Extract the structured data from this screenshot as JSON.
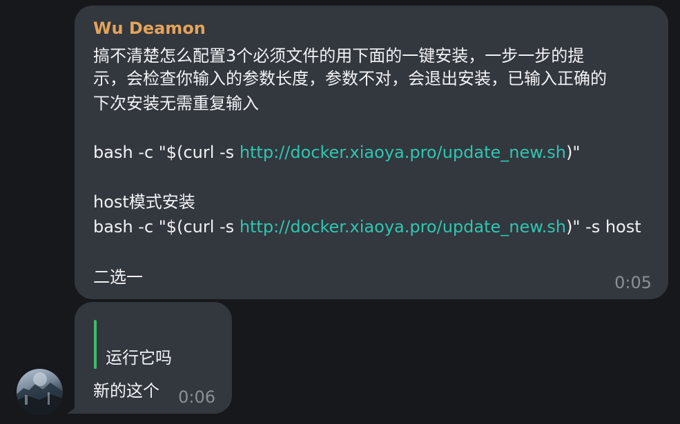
{
  "messages": [
    {
      "sender": "Wu Deamon",
      "lines": [
        "搞不清楚怎么配置3个必须文件的用下面的一键安装，一步一步的提",
        "示，会检查你输入的参数长度，参数不对，会退出安装，已输入正确的",
        "下次安装无需重复输入"
      ],
      "command1": {
        "prefix": "bash -c \"$(curl -s ",
        "link": "http://docker.xiaoya.pro/update_new.sh",
        "suffix": ")\""
      },
      "host_label": "host模式安装",
      "command2": {
        "prefix": "bash -c \"$(curl -s ",
        "link": "http://docker.xiaoya.pro/update_new.sh",
        "suffix": ")\"  -s host"
      },
      "footer": "二选一",
      "time": "0:05"
    },
    {
      "quote": "运行它吗",
      "text": "新的这个",
      "time": "0:06"
    }
  ],
  "colors": {
    "background": "#17181c",
    "bubble": "#33373e",
    "sender": "#e4a45a",
    "link": "#2fc6b1",
    "quote_bar": "#3fbb6f"
  }
}
